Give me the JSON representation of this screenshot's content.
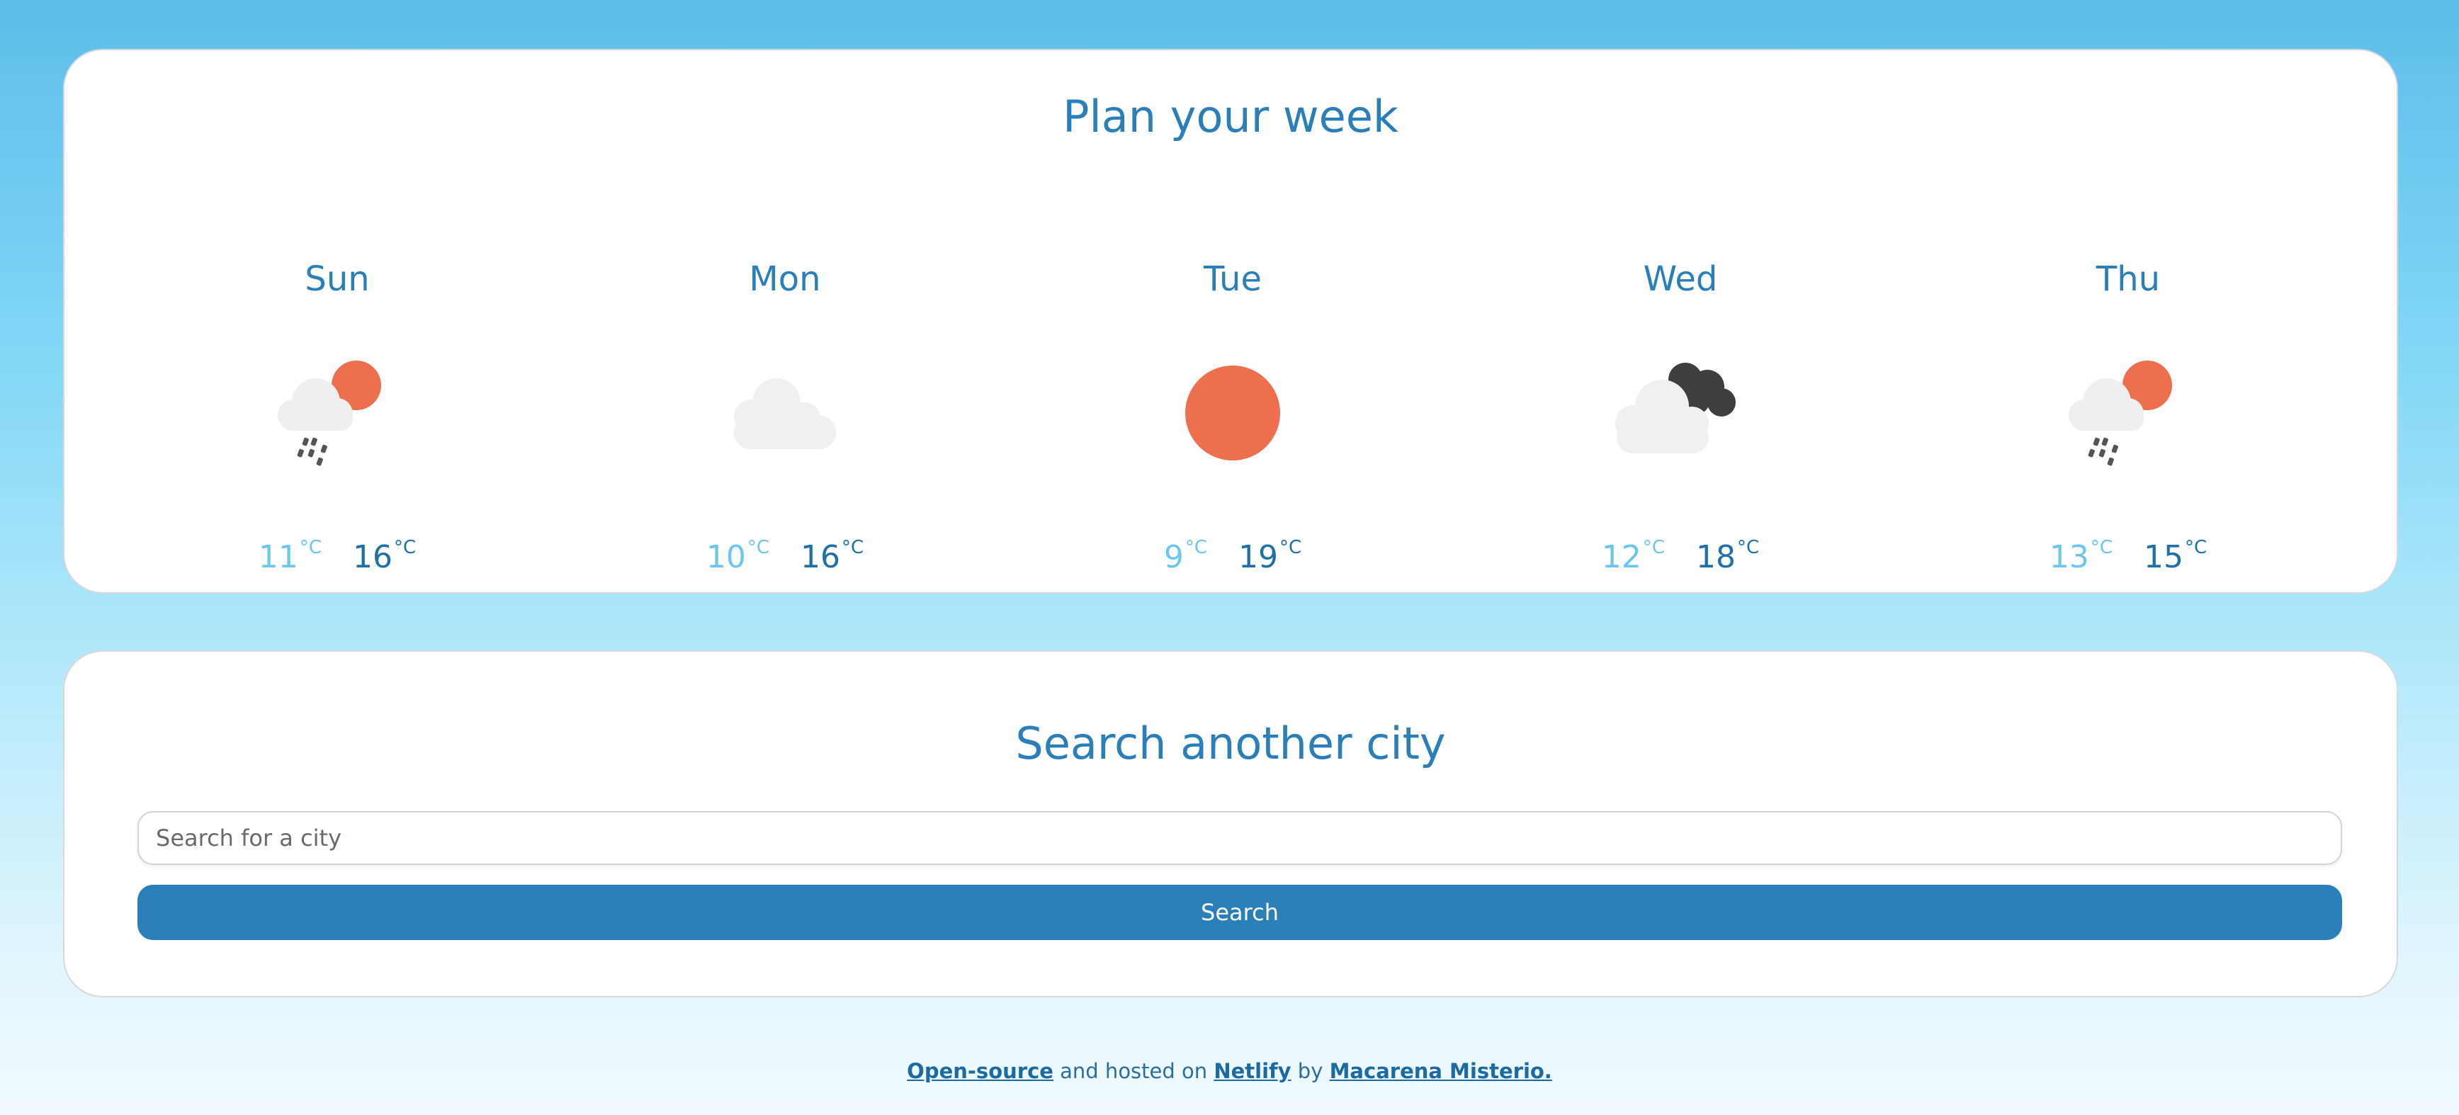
{
  "week": {
    "title": "Plan your week",
    "days": [
      {
        "name": "Sun",
        "icon": "sun-cloud-rain-icon",
        "min": "11",
        "max": "16",
        "unit": "°C"
      },
      {
        "name": "Mon",
        "icon": "cloud-icon",
        "min": "10",
        "max": "16",
        "unit": "°C"
      },
      {
        "name": "Tue",
        "icon": "sun-icon",
        "min": "9",
        "max": "19",
        "unit": "°C"
      },
      {
        "name": "Wed",
        "icon": "dark-clouds-icon",
        "min": "12",
        "max": "18",
        "unit": "°C"
      },
      {
        "name": "Thu",
        "icon": "sun-cloud-rain-icon",
        "min": "13",
        "max": "15",
        "unit": "°C"
      }
    ]
  },
  "search": {
    "title": "Search another city",
    "placeholder": "Search for a city",
    "button_label": "Search"
  },
  "footer": {
    "link_opensource": "Open-source",
    "text_hosted": " and hosted on ",
    "link_netlify": "Netlify",
    "text_by": " by ",
    "link_author": "Macarena Misterio."
  },
  "colors": {
    "accent": "#2a7fba",
    "min_temp": "#6cc6ef",
    "max_temp": "#2070a8",
    "sun": "#ee6f4e",
    "cloud": "#f0f0f0",
    "dark_cloud": "#3e3e3e"
  }
}
